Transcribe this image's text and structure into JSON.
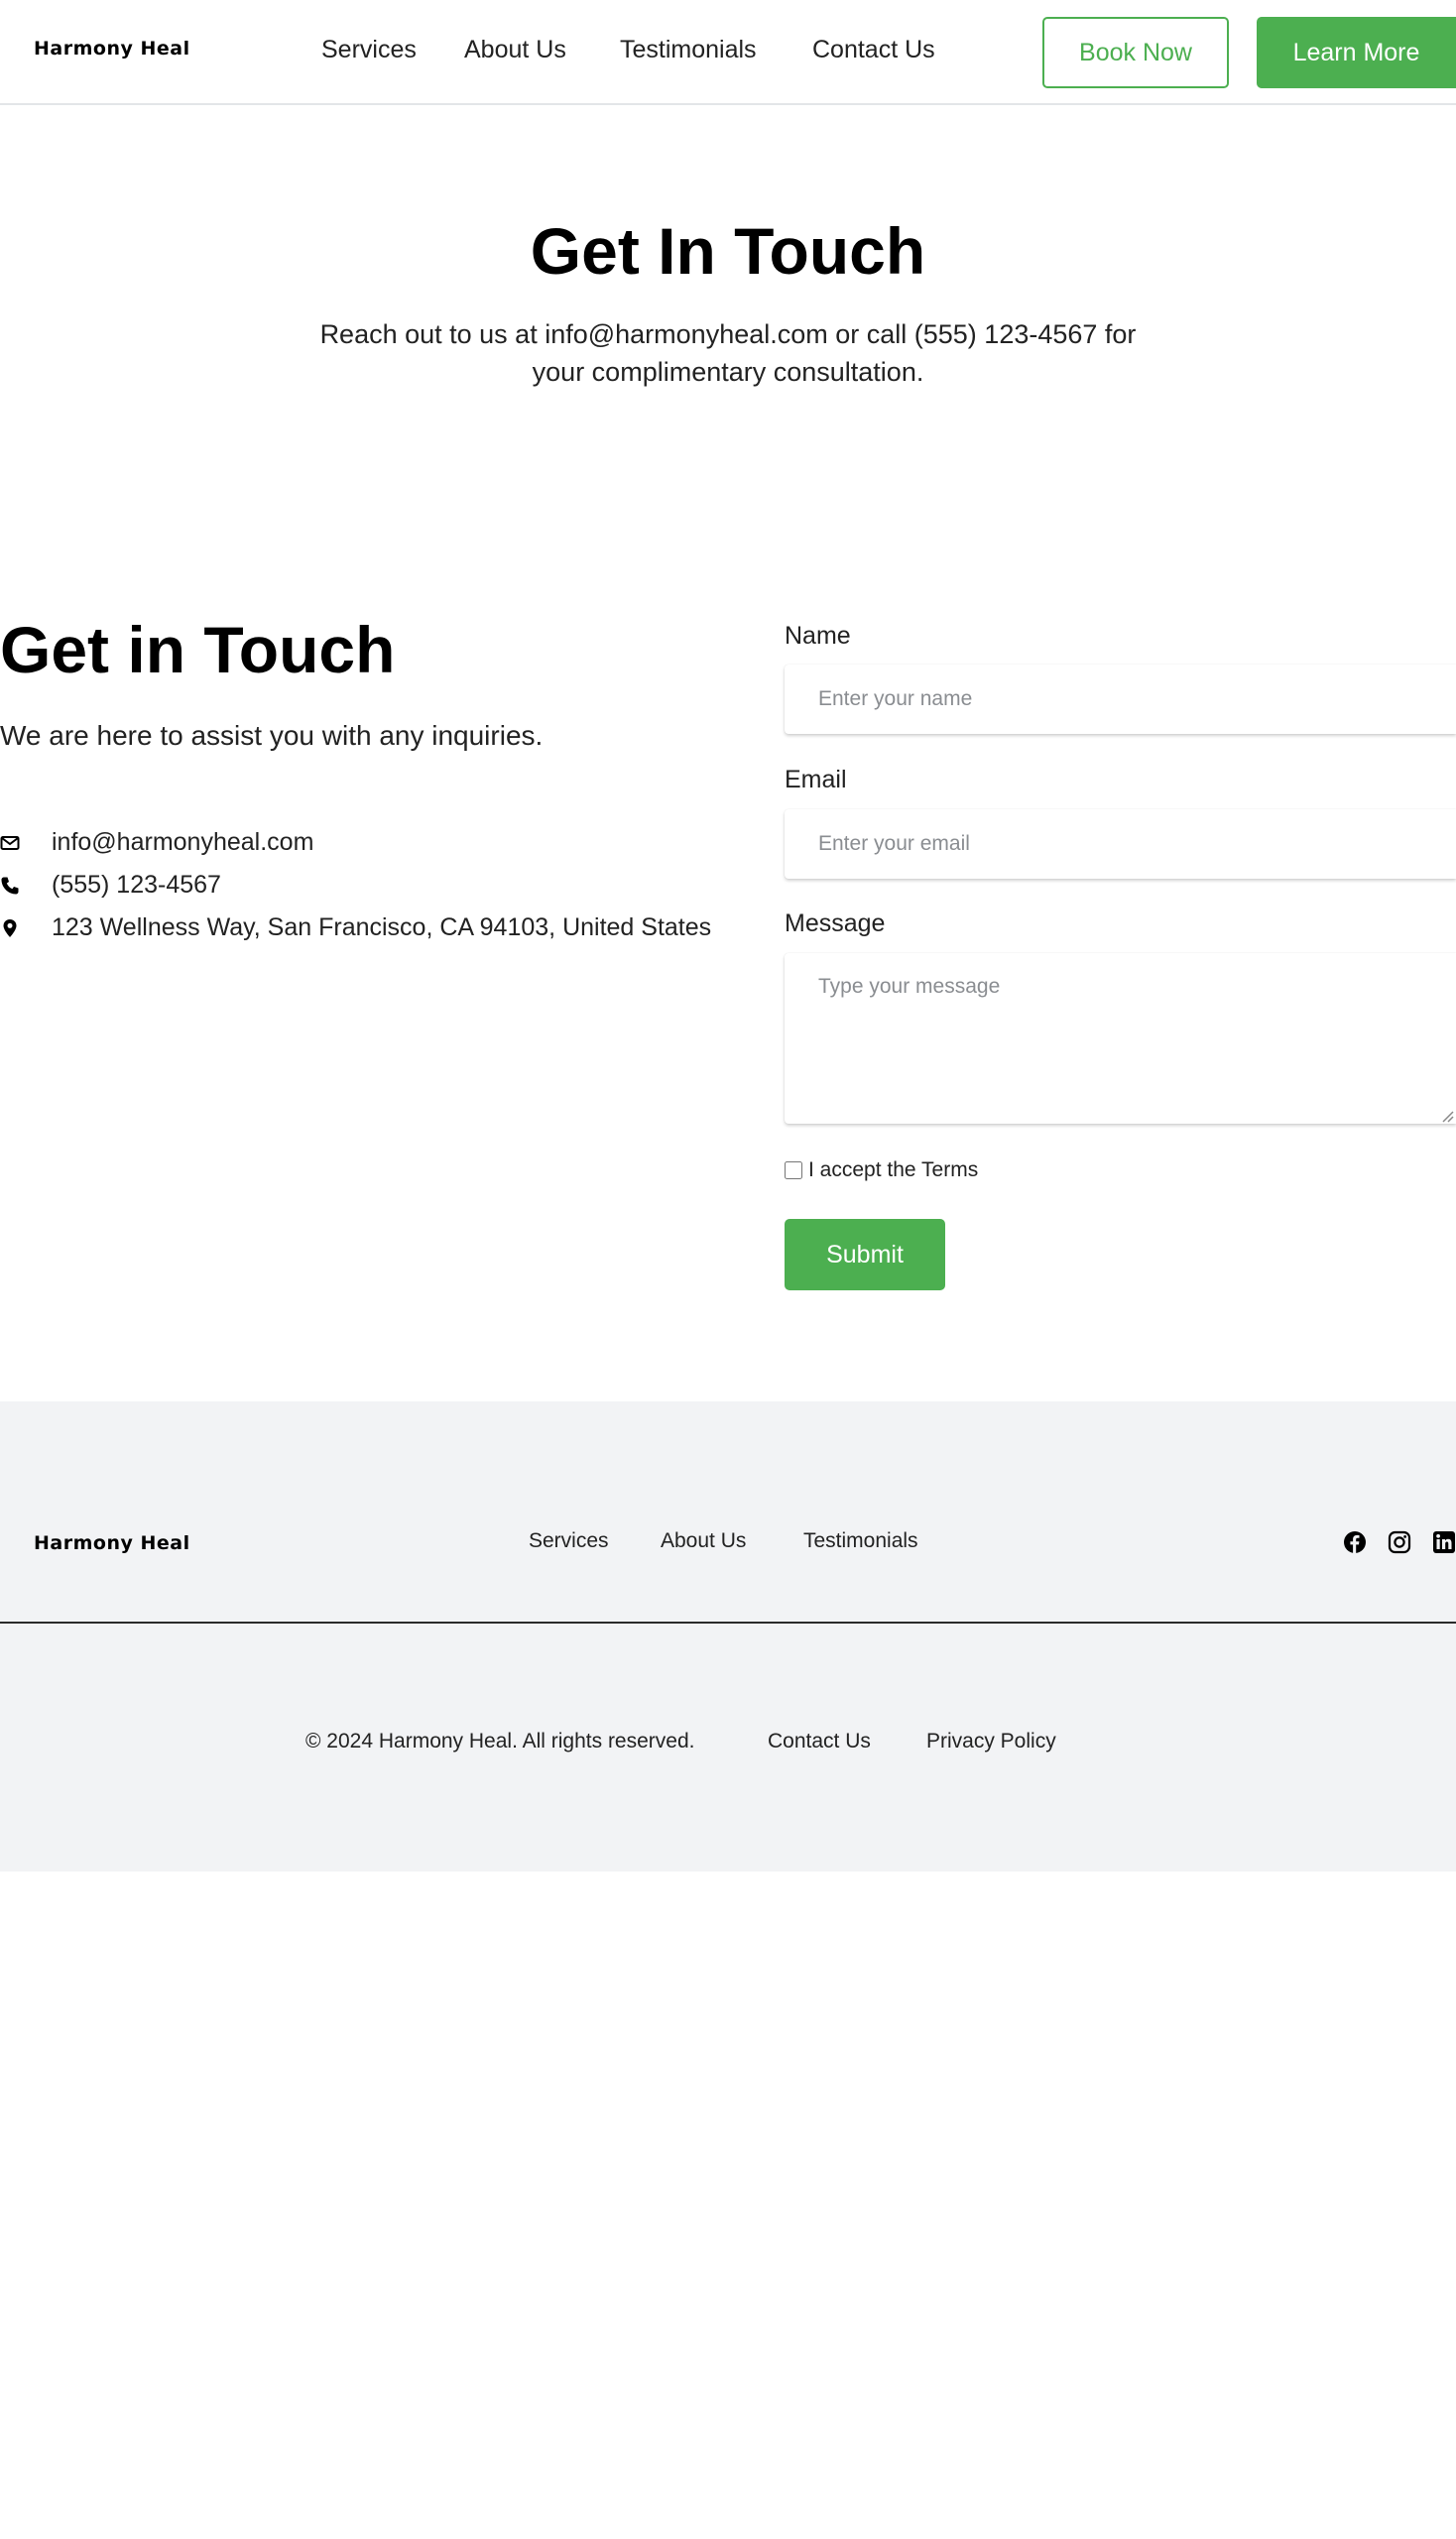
{
  "header": {
    "brand": "Harmony Heal",
    "nav": [
      "Services",
      "About Us",
      "Testimonials",
      "Contact Us"
    ],
    "book_label": "Book Now",
    "learn_label": "Learn More"
  },
  "hero": {
    "title": "Get In Touch",
    "subtitle": "Reach out to us at info@harmonyheal.com or call (555) 123-4567 for your complimentary consultation."
  },
  "contact": {
    "title": "Get in Touch",
    "subtitle": "We are here to assist you with any inquiries.",
    "email": "info@harmonyheal.com",
    "phone": "(555) 123-4567",
    "address": "123 Wellness Way, San Francisco, CA 94103, United States"
  },
  "form": {
    "name_label": "Name",
    "name_placeholder": "Enter your name",
    "email_label": "Email",
    "email_placeholder": "Enter your email",
    "message_label": "Message",
    "message_placeholder": "Type your message",
    "terms_label": "I accept the Terms",
    "submit_label": "Submit"
  },
  "footer": {
    "brand": "Harmony Heal",
    "nav": [
      "Services",
      "About Us",
      "Testimonials"
    ],
    "social_icons": [
      "facebook-icon",
      "instagram-icon",
      "linkedin-icon"
    ],
    "copyright": "© 2024 Harmony Heal. All rights reserved.",
    "contact_link": "Contact Us",
    "privacy_link": "Privacy Policy"
  },
  "colors": {
    "accent": "#4caf50",
    "footer_bg": "#f2f3f5",
    "text": "#222222"
  }
}
